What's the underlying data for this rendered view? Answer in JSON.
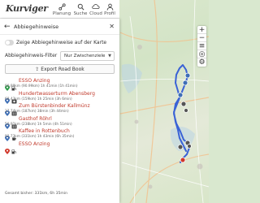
{
  "app": {
    "logo": "Kurviger",
    "nav": [
      {
        "icon": "route-planning-icon",
        "label": "Planung"
      },
      {
        "icon": "search-icon",
        "label": "Suche"
      },
      {
        "icon": "cloud-icon",
        "label": "Cloud"
      },
      {
        "icon": "user-icon",
        "label": "Profil"
      }
    ]
  },
  "panel": {
    "title": "Abbiegehinweise",
    "toggle_label": "Zeige Abbiegehinweise auf der Karte",
    "toggle_on": false,
    "filter_label": "Abbiegehinweis-Filter",
    "filter_value": "Nur Zwischenziele",
    "export_label": "Export Road Book",
    "stops": [
      {
        "name": "ESSO Anzing",
        "meta": "90.99km (90.99km) 1h 41min (1h 41min)",
        "pin_color": "#2e9b4a",
        "category": "fuel"
      },
      {
        "name": "Hundertwasserturm Abensberg",
        "meta": "68.43km (159km) 1h 25min (3h 6min)",
        "pin_color": "#3f6fb5",
        "category": "landmark"
      },
      {
        "name": "Zum Bürstenbinder Kallmünz",
        "meta": "27.74km (187km) 38min (3h 44min)",
        "pin_color": "#3f6fb5",
        "category": "restaurant"
      },
      {
        "name": "Gasthof Röhrl",
        "meta": "50.91km (238km) 1h 5min (4h 51min)",
        "pin_color": "#3f6fb5",
        "category": "restaurant"
      },
      {
        "name": "Kaffee in Rottenbuch",
        "meta": "92.73km (331km) 1h 43min (6h 35min)",
        "pin_color": "#3f6fb5",
        "category": "cafe"
      },
      {
        "name": "ESSO Anzing",
        "meta": "",
        "pin_color": "#d0362a",
        "category": "fuel"
      }
    ],
    "total": "Gesamt bisher: 331km, 6h 35min"
  },
  "map": {
    "controls": [
      "+",
      "−"
    ],
    "route_color": "#3a62d6",
    "scale": "10 km"
  }
}
